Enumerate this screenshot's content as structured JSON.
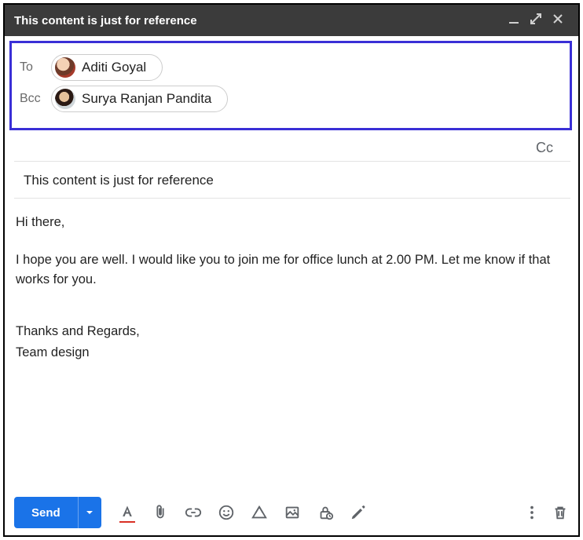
{
  "window": {
    "title": "This content is just for reference"
  },
  "recipients": {
    "to_label": "To",
    "bcc_label": "Bcc",
    "to_name": "Aditi Goyal",
    "bcc_name": "Surya Ranjan Pandita",
    "cc_toggle": "Cc"
  },
  "subject": "This content is just for reference",
  "body": {
    "greeting": "Hi there,",
    "paragraph": "I hope you are well. I would like you to join me for office lunch at 2.00 PM. Let me know if that works for you.",
    "sig1": "Thanks and Regards,",
    "sig2": "Team design"
  },
  "toolbar": {
    "send_label": "Send"
  }
}
